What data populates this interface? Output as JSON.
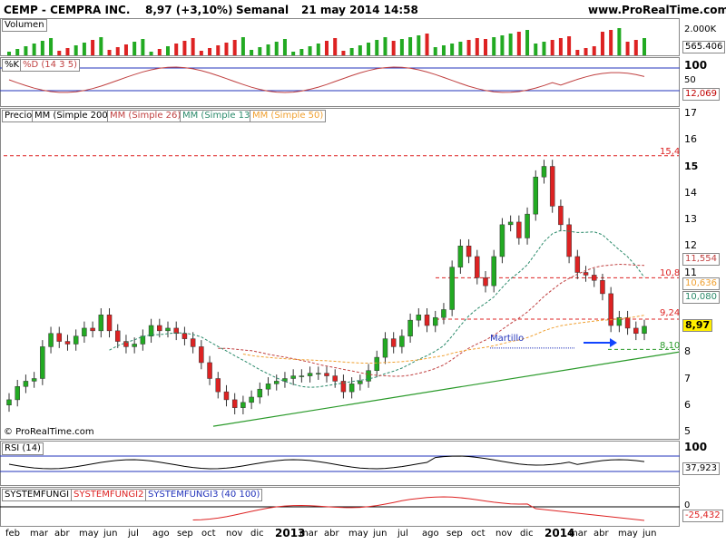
{
  "header": {
    "symbol": "CEMP - CEMPRA INC.",
    "price": "8,97 (+3,10%)",
    "period": "Semanal",
    "date": "21 may 2014 14:58",
    "site": "www.ProRealTime.com"
  },
  "copyright": "© ProRealTime.com",
  "colors": {
    "up": "#22aa22",
    "down": "#dd2222",
    "ma200": "#c00000",
    "ma26": "#c04040",
    "ma13": "#2a8a6a",
    "ma50": "#f0a030",
    "trend": "#2a9a2a"
  },
  "panels": {
    "volumen": {
      "label": "Volumen",
      "ticks": [
        "2.000K",
        "565.406"
      ]
    },
    "stoch": {
      "label_k": "%K",
      "label_d": "%D (14 3 5)",
      "ticks": [
        "100",
        "50",
        "12,069"
      ]
    },
    "price": {
      "labels": [
        "Precio",
        "MM (Simple 200)",
        "MM (Simple 26)",
        "MM (Simple 13)",
        "MM (Simple 50)"
      ],
      "ticks": [
        "17",
        "16",
        "15",
        "14",
        "13",
        "12",
        "11",
        "10",
        "9",
        "8",
        "7",
        "6",
        "5"
      ],
      "badges": [
        "11,554",
        "10,636",
        "10,080",
        "8,97"
      ],
      "level_labels": [
        "15,4",
        "10,8",
        "9,24",
        "8,10"
      ],
      "annotation": "Martillo"
    },
    "rsi": {
      "label": "RSI (14)",
      "ticks": [
        "100",
        "37,923"
      ]
    },
    "systemfungi": {
      "labels": [
        "SYSTEMFUNGI",
        "SYSTEMFUNGI2",
        "SYSTEMFUNGI3 (40 100)"
      ],
      "ticks": [
        "0",
        "-25,432"
      ]
    }
  },
  "xaxis": [
    "feb",
    "mar",
    "abr",
    "may",
    "jun",
    "jul",
    "ago",
    "sep",
    "oct",
    "nov",
    "dic",
    "2013",
    "mar",
    "abr",
    "may",
    "jun",
    "jul",
    "ago",
    "sep",
    "oct",
    "nov",
    "dic",
    "2014",
    "mar",
    "abr",
    "may",
    "jun"
  ],
  "chart_data": {
    "type": "candlestick",
    "title": "CEMP - CEMPRA INC.",
    "timeframe": "Semanal",
    "ylim": [
      5,
      17
    ],
    "levels": [
      15.4,
      10.8,
      9.24,
      8.1
    ],
    "last": 8.97,
    "ma_last": {
      "ma26": 11.554,
      "ma50": 10.636,
      "ma13": 10.08
    },
    "close_series": [
      6.2,
      6.7,
      6.9,
      7.0,
      8.2,
      8.7,
      8.4,
      8.3,
      8.6,
      8.9,
      8.8,
      9.4,
      8.8,
      8.4,
      8.2,
      8.3,
      8.6,
      9.0,
      8.8,
      8.9,
      8.7,
      8.5,
      8.2,
      7.6,
      7.0,
      6.5,
      6.2,
      5.9,
      6.1,
      6.3,
      6.6,
      6.8,
      6.9,
      7.0,
      7.1,
      7.1,
      7.2,
      7.2,
      7.1,
      6.9,
      6.5,
      6.8,
      6.9,
      7.3,
      7.8,
      8.5,
      8.2,
      8.6,
      9.2,
      9.4,
      9.0,
      9.3,
      9.6,
      11.2,
      12.0,
      11.6,
      10.8,
      10.5,
      11.6,
      12.8,
      12.9,
      12.3,
      13.2,
      14.6,
      15.0,
      13.5,
      12.8,
      11.6,
      11.0,
      10.9,
      10.7,
      10.2,
      9.0,
      9.3,
      8.9,
      8.7,
      8.97
    ],
    "volume_last": 565.406,
    "stoch_last": 12.069,
    "rsi_last": 37.923,
    "systemfungi_last": -25.432
  }
}
